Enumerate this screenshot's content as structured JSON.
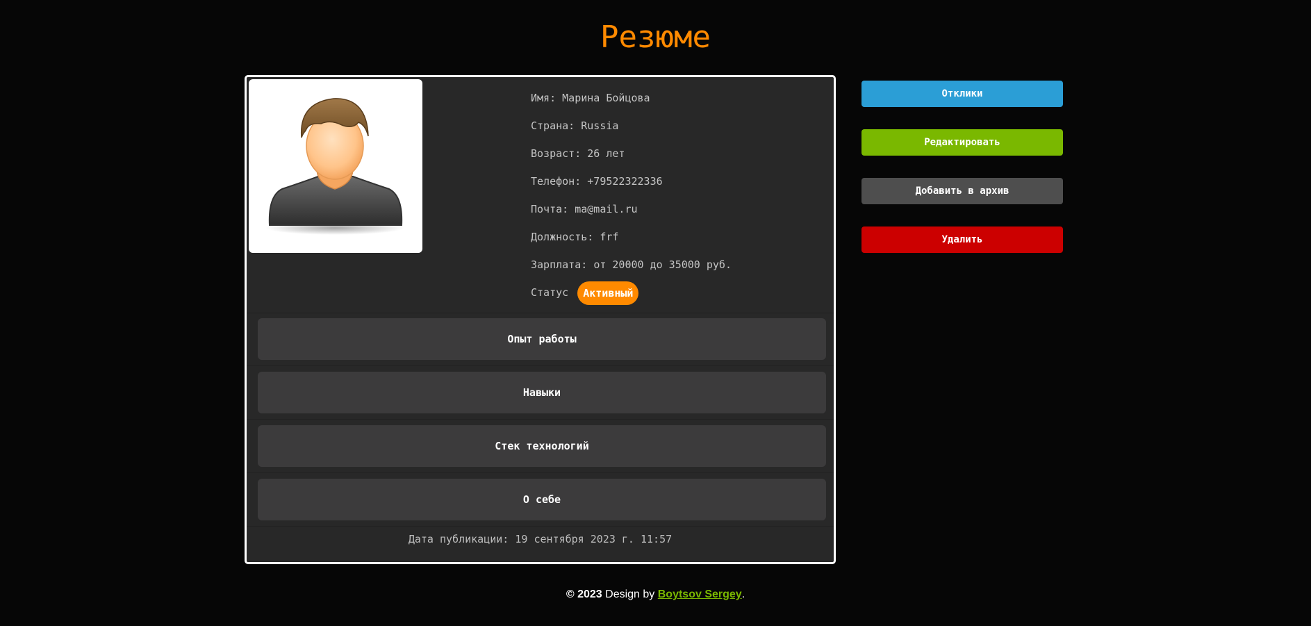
{
  "page": {
    "title": "Резюме"
  },
  "profile": {
    "name_label": "Имя:",
    "name": "Марина Бойцова",
    "country_label": "Страна:",
    "country": "Russia",
    "age_label": "Возраст:",
    "age": "26 лет",
    "phone_label": "Телефон:",
    "phone": "+79522322336",
    "email_label": "Почта:",
    "email": "ma@mail.ru",
    "position_label": "Должность:",
    "position": "frf",
    "salary_label": "Зарплата:",
    "salary": "от 20000 до 35000 руб.",
    "status_label": "Статус",
    "status": "Активный"
  },
  "sections": [
    {
      "label": "Опыт работы"
    },
    {
      "label": "Навыки"
    },
    {
      "label": "Стек технологий"
    },
    {
      "label": "О себе"
    }
  ],
  "publication": {
    "text": "Дата публикации: 19 сентября 2023 г. 11:57"
  },
  "actions": {
    "responses": "Отклики",
    "edit": "Редактировать",
    "archive": "Добавить в архив",
    "delete": "Удалить"
  },
  "footer": {
    "copyright": "©",
    "year": "2023",
    "design_by": "Design by",
    "author": "Boytsov Sergey",
    "period": "."
  },
  "colors": {
    "accent_orange": "#ff8a00",
    "responses_blue": "#2b9ed6",
    "edit_green": "#7ab800",
    "archive_gray": "#4e4e4e",
    "delete_red": "#cc0000",
    "card_bg": "#282828",
    "section_bg": "#3c3b3c"
  },
  "icons": {
    "avatar": "person-avatar-icon"
  }
}
